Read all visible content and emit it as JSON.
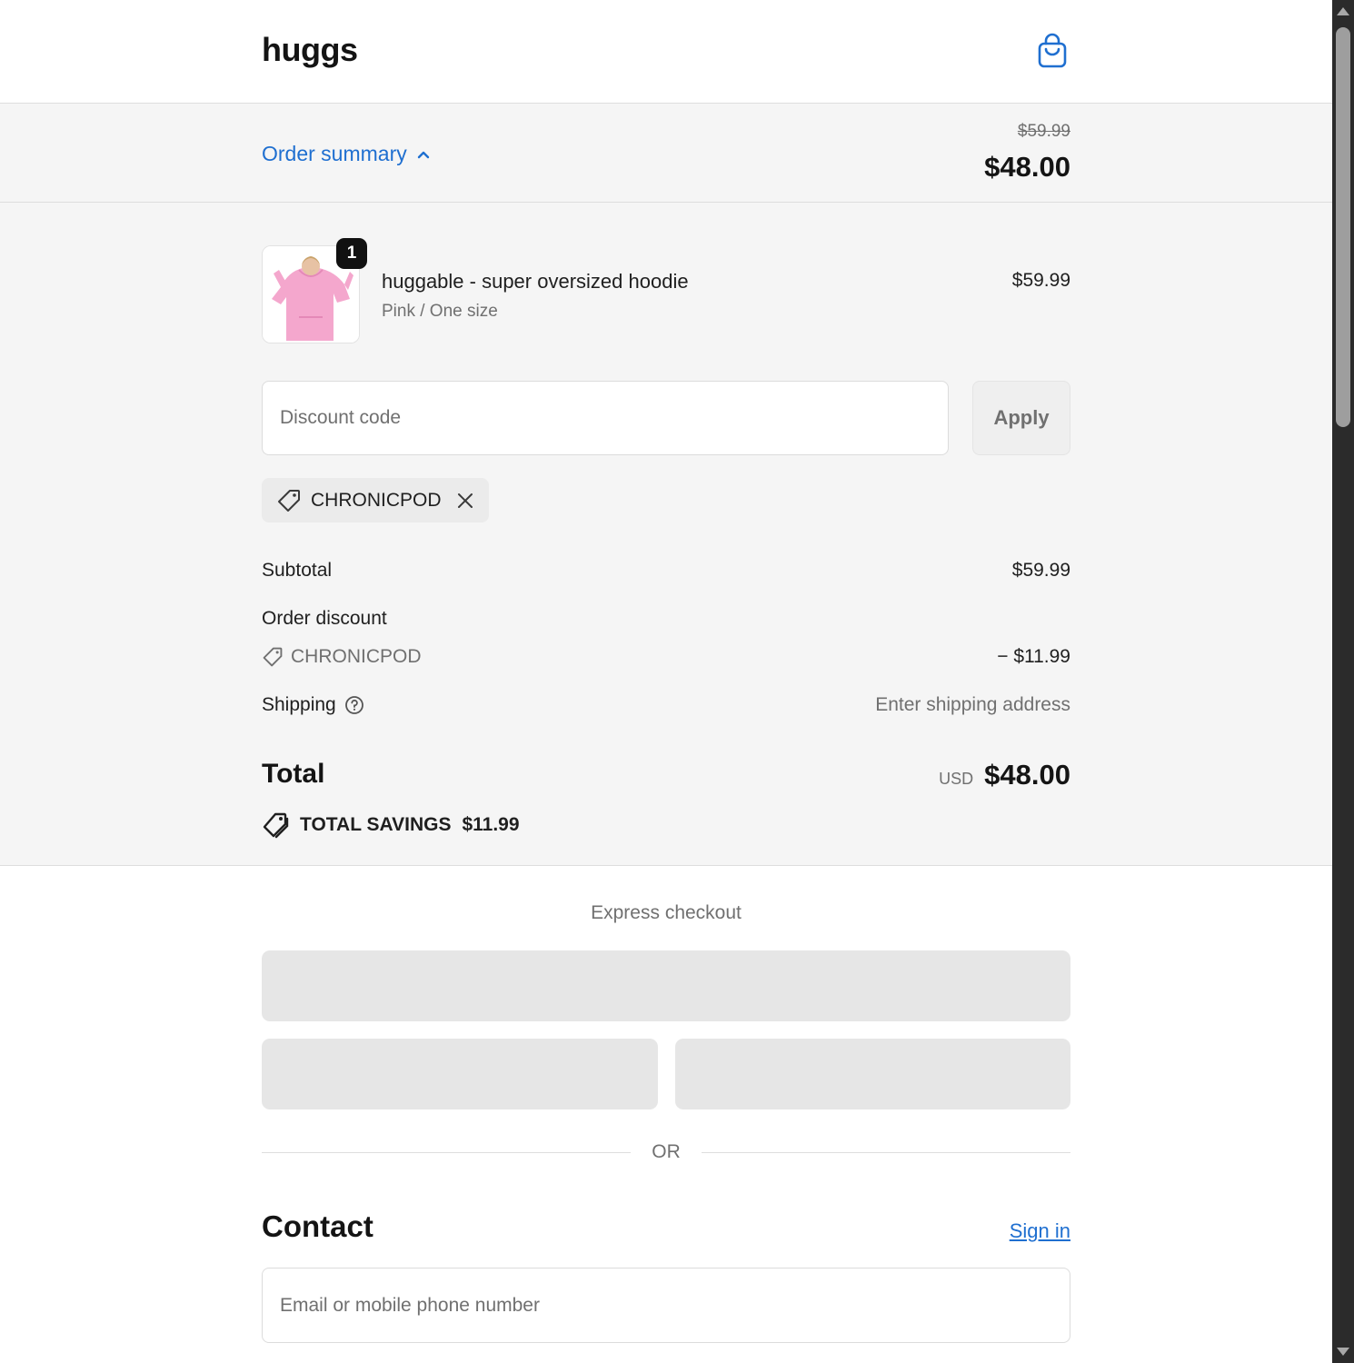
{
  "header": {
    "logo": "huggs",
    "cart_icon": "shopping-bag-icon"
  },
  "summary_bar": {
    "toggle_label": "Order summary",
    "toggle_icon": "chevron-up-icon",
    "original_price": "$59.99",
    "total_price": "$48.00"
  },
  "product": {
    "quantity": "1",
    "name": "huggable - super oversized hoodie",
    "variant": "Pink / One size",
    "price": "$59.99",
    "image_icon": "pink-hoodie-image"
  },
  "discount": {
    "placeholder": "Discount code",
    "apply_label": "Apply",
    "applied_code": "CHRONICPOD",
    "tag_icon": "tag-icon",
    "remove_icon": "close-icon"
  },
  "totals": {
    "subtotal_label": "Subtotal",
    "subtotal_value": "$59.99",
    "order_discount_label": "Order discount",
    "discount_code": "CHRONICPOD",
    "discount_value": "− $11.99",
    "shipping_label": "Shipping",
    "shipping_value": "Enter shipping address",
    "total_label": "Total",
    "currency": "USD",
    "total_value": "$48.00",
    "savings_label": "TOTAL SAVINGS",
    "savings_value": "$11.99"
  },
  "express": {
    "title": "Express checkout",
    "or_label": "OR"
  },
  "contact": {
    "title": "Contact",
    "sign_in": "Sign in",
    "email_placeholder": "Email or mobile phone number"
  },
  "colors": {
    "accent": "#1f6fd0",
    "panel_bg": "#f5f5f5",
    "muted_text": "#707070"
  }
}
